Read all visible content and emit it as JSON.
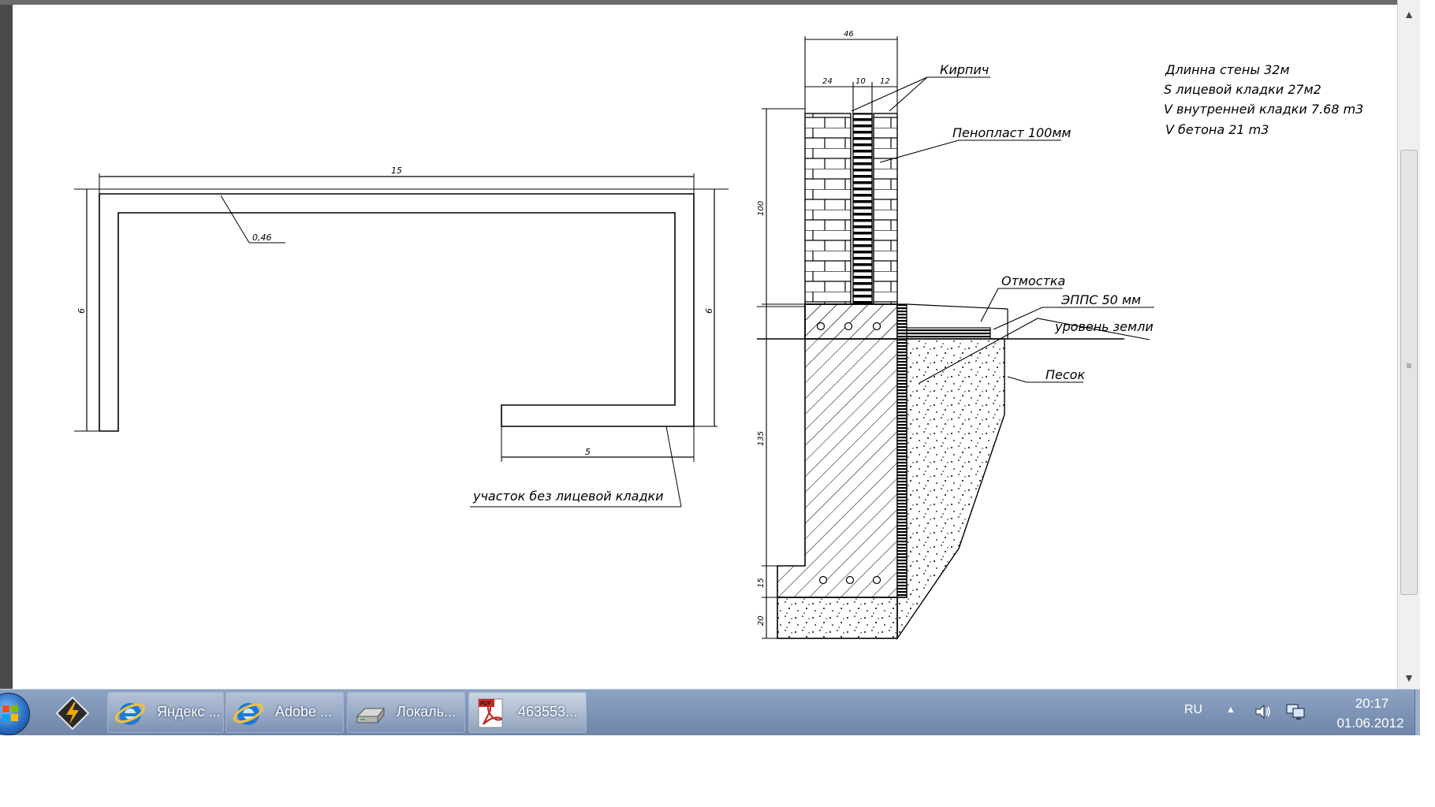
{
  "drawing": {
    "plan": {
      "dim_length": "15",
      "dim_thickness": "0,46",
      "dim_left_side": "6",
      "dim_right_side": "6",
      "dim_bottom_segment": "5",
      "note_no_facing": "участок без лицевой кладки"
    },
    "section": {
      "dim_total_width": "46",
      "dim_brick": "24",
      "dim_insulation": "10",
      "dim_facing": "12",
      "dim_wall_height": "100",
      "dim_foundation_height": "135",
      "dim_footing": "15",
      "dim_sand_bed": "20",
      "label_brick": "Кирпич",
      "label_foam": "Пенопласт 100мм",
      "label_blind_area": "Отмостка",
      "label_epps": "ЭППС 50 мм",
      "label_ground_level": "уровень земли",
      "label_sand": "Песок"
    },
    "summary": {
      "wall_length": "Длинна стены 32м",
      "facing_area": "S лицевой кладки 27м2",
      "inner_volume": "V внутренней кладки 7.68 m3",
      "concrete_volume": "V бетона 21 m3"
    }
  },
  "taskbar": {
    "buttons": [
      {
        "label": "Яндекс ...",
        "icon": "internet-explorer-icon"
      },
      {
        "label": "Adobe ...",
        "icon": "internet-explorer-icon"
      },
      {
        "label": "Локаль...",
        "icon": "drive-icon"
      },
      {
        "label": "463553...",
        "icon": "pdf-icon"
      }
    ],
    "language": "RU",
    "time": "20:17",
    "date": "01.06.2012"
  },
  "colors": {
    "taskbar": "#7a8fb2",
    "drawing_ink": "#000000",
    "window_frame": "#4a4a4a"
  }
}
